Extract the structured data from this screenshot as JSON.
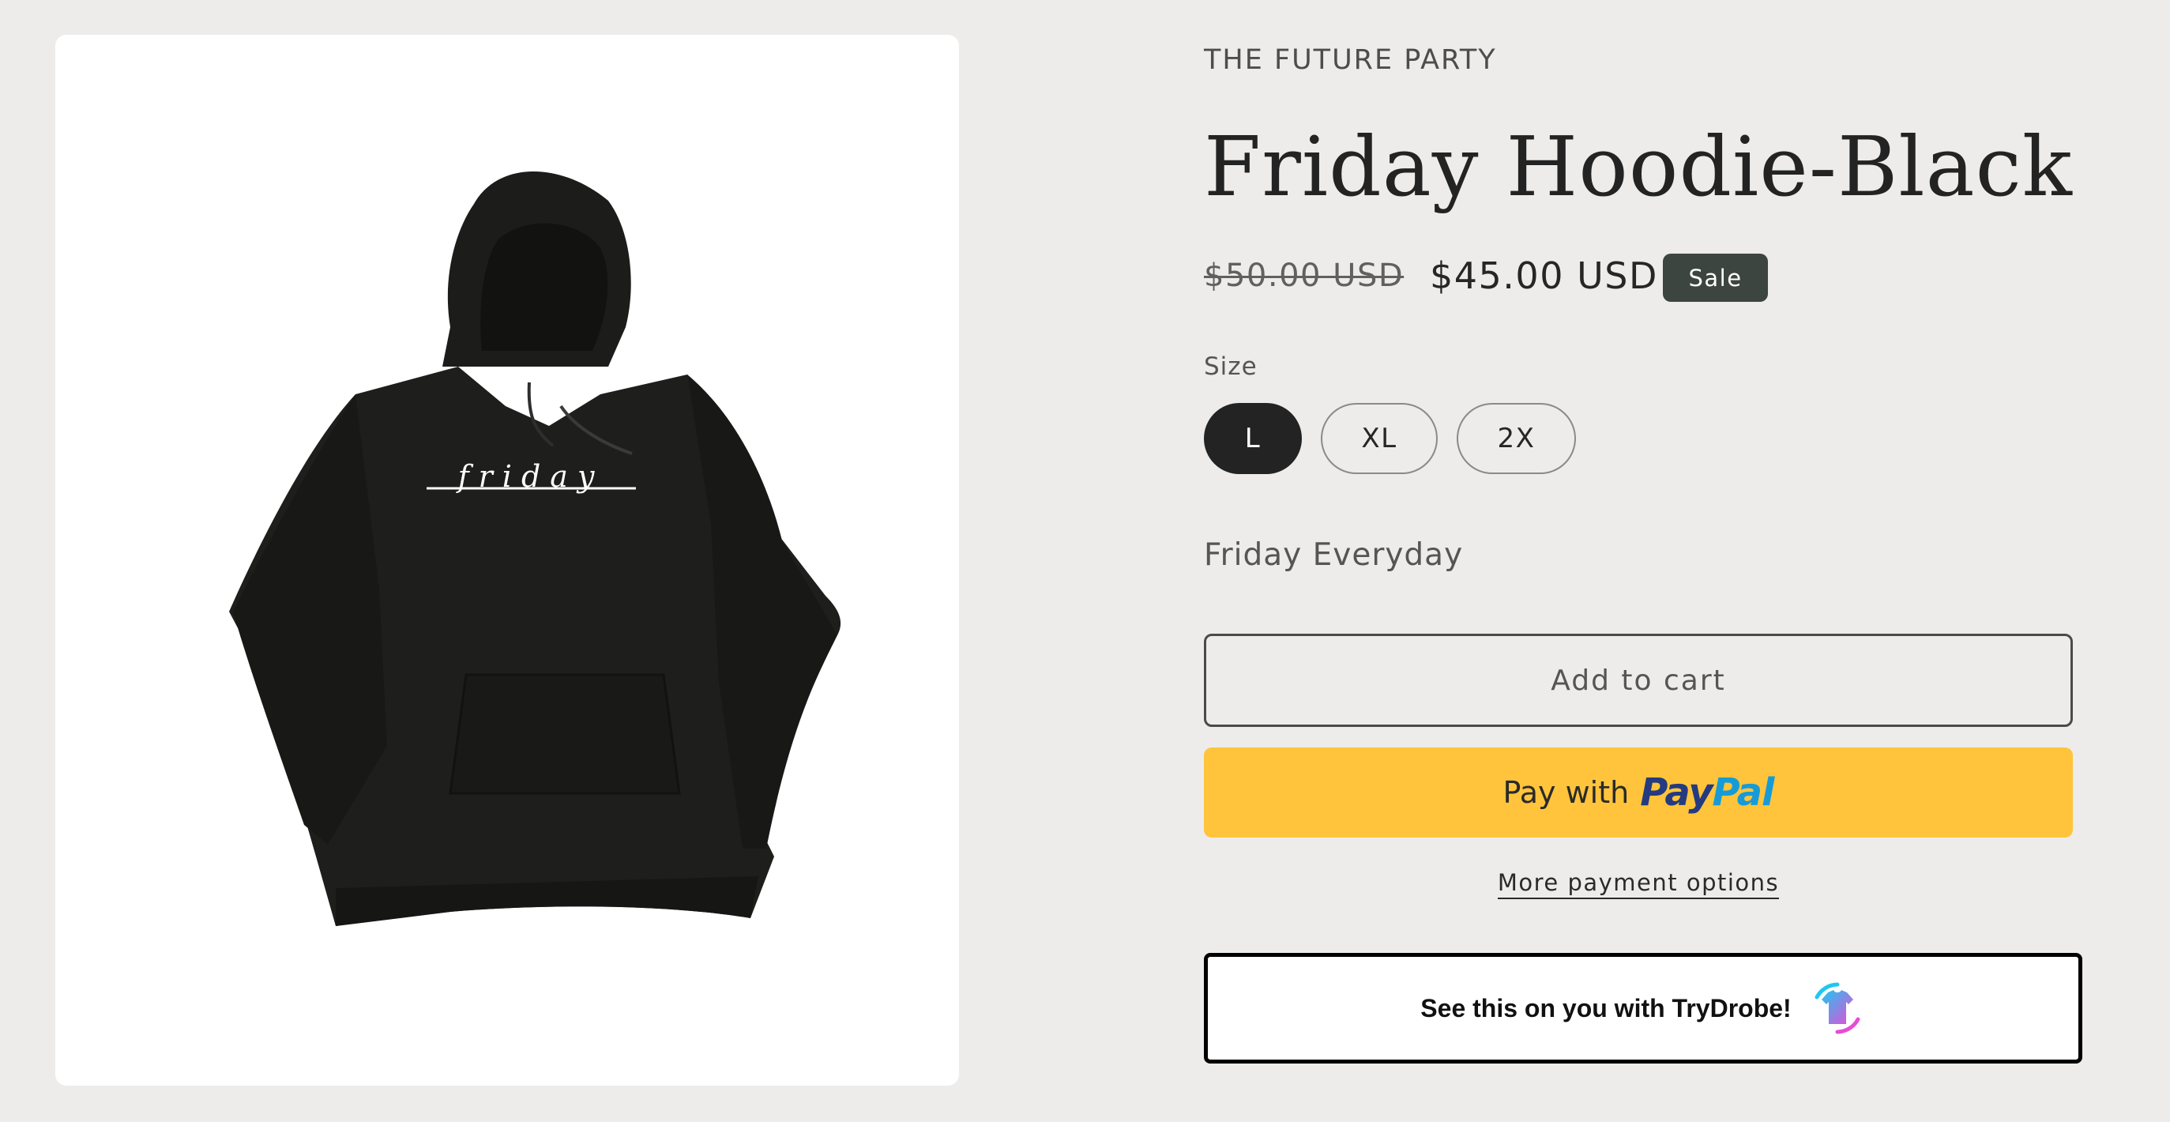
{
  "product": {
    "vendor": "THE FUTURE PARTY",
    "title": "Friday Hoodie-Black",
    "price_regular": "$50.00 USD",
    "price_sale": "$45.00 USD",
    "sale_badge": "Sale",
    "size_label": "Size",
    "sizes": [
      {
        "label": "L",
        "selected": true
      },
      {
        "label": "XL",
        "selected": false
      },
      {
        "label": "2X",
        "selected": false
      }
    ],
    "tagline": "Friday Everyday",
    "image_print_text": "friday"
  },
  "actions": {
    "add_to_cart_label": "Add to cart",
    "paypal_prefix": "Pay with",
    "paypal_brand_part1": "Pay",
    "paypal_brand_part2": "Pal",
    "more_payment_options": "More payment options",
    "trydrobe_label": "See this on you with TryDrobe!"
  },
  "icons": {
    "trydrobe": "tshirt-gradient-icon",
    "product_image": "black-hoodie-image"
  },
  "colors": {
    "page_background": "#edecea",
    "sale_badge": "#3d4541",
    "selected_size": "#232323",
    "paypal_button": "#ffc43b",
    "paypal_dark_blue": "#253b80",
    "paypal_light_blue": "#179bd7"
  }
}
